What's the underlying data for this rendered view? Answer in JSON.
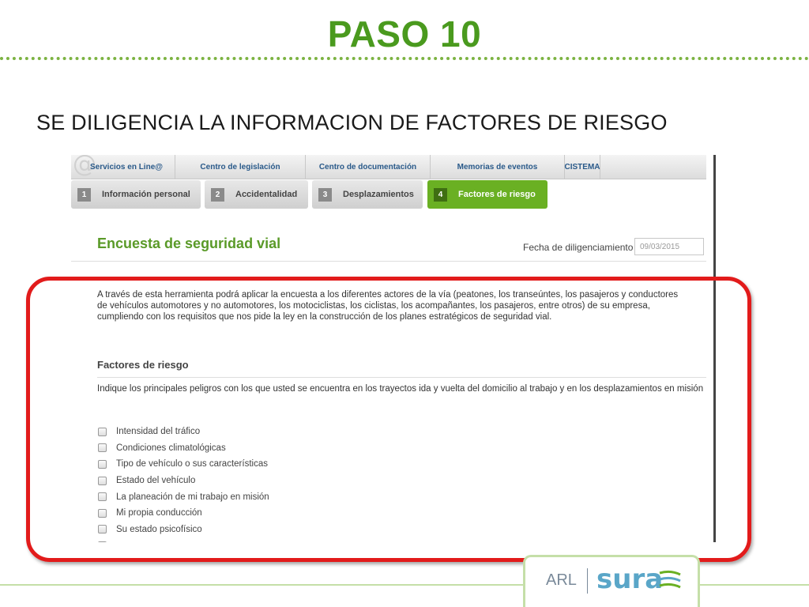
{
  "slide": {
    "title": "PASO 10",
    "subtitle": "SE DILIGENCIA LA INFORMACION DE FACTORES DE RIESGO"
  },
  "nav": {
    "items": [
      {
        "label": "Servicios en Line@"
      },
      {
        "label": "Centro de legislación"
      },
      {
        "label": "Centro de documentación"
      },
      {
        "label": "Memorias de eventos"
      },
      {
        "label": "CISTEMA"
      }
    ]
  },
  "tabs": [
    {
      "number": "1",
      "label": "Información personal",
      "active": false
    },
    {
      "number": "2",
      "label": "Accidentalidad",
      "active": false
    },
    {
      "number": "3",
      "label": "Desplazamientos",
      "active": false
    },
    {
      "number": "4",
      "label": "Factores de riesgo",
      "active": true
    }
  ],
  "form": {
    "title": "Encuesta de seguridad vial",
    "date_label": "Fecha de diligenciamiento",
    "date_value": "09/03/2015",
    "intro": "A través de esta herramienta podrá aplicar la encuesta a los diferentes actores de la vía (peatones, los transeúntes, los pasajeros y conductores de vehículos automotores y no automotores, los motociclistas, los ciclistas, los acompañantes, los pasajeros, entre otros) de su empresa, cumpliendo con los requisitos que nos pide la ley en la construcción de los planes estratégicos de seguridad vial.",
    "section_title": "Factores de riesgo",
    "instructions": "Indique los principales peligros con los que usted se encuentra en los trayectos ida y vuelta del domicilio al trabajo y en los desplazamientos en misión",
    "options": [
      {
        "label": "Intensidad del tráfico",
        "checked": false
      },
      {
        "label": "Condiciones climatológicas",
        "checked": false
      },
      {
        "label": "Tipo de vehículo o sus características",
        "checked": false
      },
      {
        "label": "Estado del vehículo",
        "checked": false
      },
      {
        "label": "La planeación de mi trabajo en misión",
        "checked": false
      },
      {
        "label": "Mi propia conducción",
        "checked": false
      },
      {
        "label": "Su estado psicofísico",
        "checked": false
      }
    ]
  },
  "footer": {
    "logo_arl": "ARL",
    "logo_sura": "sura"
  },
  "colors": {
    "brand_green": "#4a9a1e",
    "active_tab": "#6ab023",
    "highlight_red": "#e21b1b",
    "sura_blue": "#5aa6c8"
  }
}
